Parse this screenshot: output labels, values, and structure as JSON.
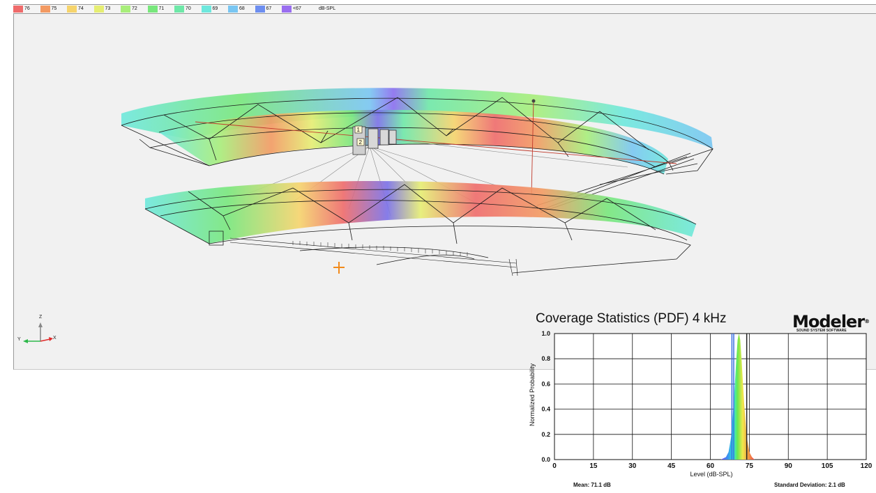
{
  "legend": {
    "items": [
      {
        "label": "76",
        "color": "#ef6b6b"
      },
      {
        "label": "75",
        "color": "#f39a62"
      },
      {
        "label": "74",
        "color": "#f6d46c"
      },
      {
        "label": "73",
        "color": "#e6ee72"
      },
      {
        "label": "72",
        "color": "#a8ee7a"
      },
      {
        "label": "71",
        "color": "#78e77c"
      },
      {
        "label": "70",
        "color": "#6ee8a8"
      },
      {
        "label": "69",
        "color": "#6ee8dd"
      },
      {
        "label": "68",
        "color": "#79c6f2"
      },
      {
        "label": "67",
        "color": "#6d8ef0"
      },
      {
        "label": "<67",
        "color": "#9a6ef0"
      }
    ],
    "unit": "dB-SPL"
  },
  "scene": {
    "speaker_labels": [
      "1",
      "2"
    ],
    "axis": {
      "z": "Z",
      "y": "Y",
      "x": "X"
    }
  },
  "chart": {
    "title": "Coverage Statistics (PDF) 4 kHz",
    "brand_name": "Modeler",
    "brand_mark": "®",
    "brand_sub": "SOUND SYSTEM SOFTWARE",
    "mean": "Mean: 71.1 dB",
    "std_dev": "Standard Deviation: 2.1 dB"
  },
  "chart_data": {
    "type": "area",
    "title": "Coverage Statistics (PDF) 4 kHz",
    "xlabel": "Level (dB-SPL)",
    "ylabel": "Normalized Probability",
    "xlim": [
      0,
      120
    ],
    "ylim": [
      0,
      1.0
    ],
    "x_ticks": [
      "0",
      "15",
      "30",
      "45",
      "60",
      "75",
      "90",
      "105",
      "120"
    ],
    "y_ticks": [
      "0.0",
      "0.2",
      "0.4",
      "0.6",
      "0.8",
      "1.0"
    ],
    "grid": true,
    "series": [
      {
        "x": [
          64,
          66,
          67,
          68,
          69,
          70,
          70.5,
          71,
          71.5,
          72,
          73,
          74,
          75,
          76,
          77
        ],
        "values": [
          0,
          0.02,
          0.06,
          0.18,
          0.45,
          0.8,
          0.95,
          1.0,
          0.95,
          0.8,
          0.45,
          0.18,
          0.06,
          0.02,
          0
        ]
      }
    ],
    "markers": [
      {
        "x": 68.3,
        "color": "#3a6ee0"
      },
      {
        "x": 69.0,
        "color": "#3a6ee0"
      },
      {
        "x": 74.0,
        "color": "#222222"
      }
    ]
  }
}
